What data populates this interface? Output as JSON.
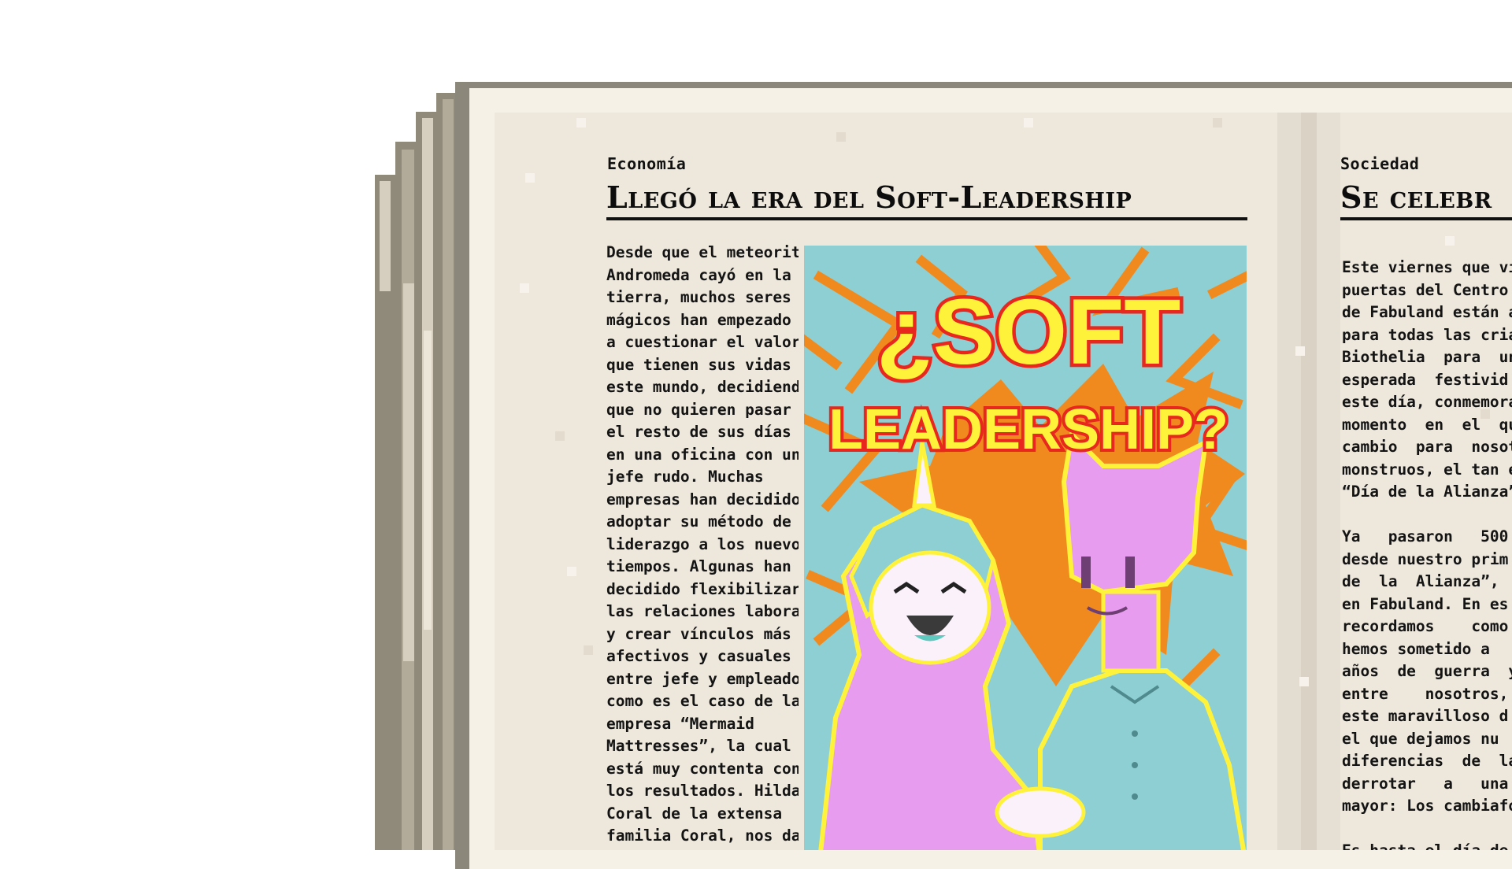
{
  "left_article": {
    "section": "Economía",
    "headline": "Llegó la era del Soft-Leadership",
    "body_lines": [
      "Desde que el meteorito",
      "Andromeda cayó en la",
      "tierra, muchos seres",
      "mágicos han empezado",
      "a cuestionar el valor",
      "que tienen sus vidas en",
      "este mundo, decidiendo",
      "que no quieren pasar",
      "el resto de sus días",
      "en una oficina con un",
      "jefe rudo. Muchas",
      "empresas han decidido",
      "adoptar su método de",
      "liderazgo a los nuevos",
      "tiempos. Algunas han",
      "decidido flexibilizar",
      "las relaciones laborales,",
      "y crear vínculos más",
      "afectivos y casuales",
      "entre jefe y empleado,",
      "como es el caso de la",
      "empresa “Mermaid",
      "Mattresses”, la cual",
      "está muy contenta con",
      "los resultados. Hilda",
      "Coral de la extensa",
      "familia Coral, nos da"
    ],
    "illustration": {
      "title_line1": "¿SOFT",
      "title_line2": "LEADERSHIP?"
    }
  },
  "right_article": {
    "section": "Sociedad",
    "headline": "Se celebr",
    "body_lines": [
      "Este viernes que vie",
      "puertas del Centro C",
      "de Fabuland están a",
      "para todas las criatu",
      "Biothelia  para  un",
      "esperada  festivid",
      "este día, conmemora",
      "momento  en  el  qu",
      "cambio  para  nosotr",
      "monstruos, el tan es",
      "“Día de la Alianza”.",
      "",
      "Ya   pasaron   500",
      "desde nuestro prim",
      "de  la  Alianza”,  ac",
      "en Fabuland. En es",
      "recordamos    como",
      "hemos sometido a",
      "años  de  guerra  y",
      "entre    nosotros,",
      "este maravilloso d",
      "el que dejamos nu",
      "diferencias  de  lad",
      "derrotar   a   una",
      "mayor: Los cambiafor",
      "",
      "Es hasta el día de h"
    ]
  },
  "colors": {
    "paper": "#ede7dc",
    "ink": "#111111",
    "illus_cyan": "#8ecfd3",
    "illus_orange": "#f08a1e",
    "illus_red": "#e8281e",
    "illus_yellow": "#fff23a",
    "illus_pink": "#e89cf0"
  }
}
